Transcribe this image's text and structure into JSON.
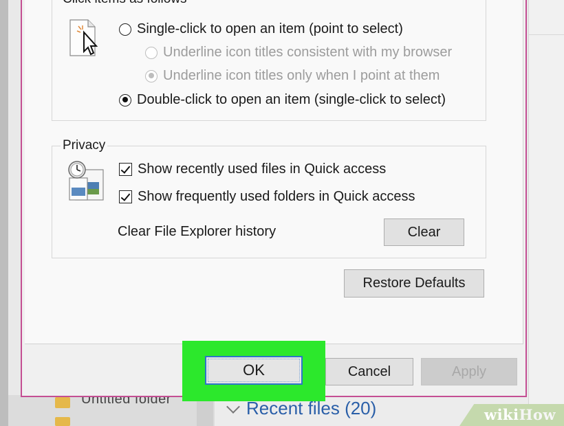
{
  "background": {
    "folder_label": "Untitled folder",
    "recent_files": "Recent files (20)",
    "watermark": {
      "wiki": "wiki",
      "how": "How"
    }
  },
  "click_items": {
    "legend": "Click items as follows",
    "single_click": "Single-click to open an item (point to select)",
    "underline_browser": "Underline icon titles consistent with my browser",
    "underline_point": "Underline icon titles only when I point at them",
    "double_click": "Double-click to open an item (single-click to select)",
    "selected": "double_click"
  },
  "privacy": {
    "legend": "Privacy",
    "show_recent_files": {
      "label": "Show recently used files in Quick access",
      "checked": true
    },
    "show_frequent_folders": {
      "label": "Show frequently used folders in Quick access",
      "checked": true
    },
    "clear_history_label": "Clear File Explorer history",
    "clear_button": "Clear"
  },
  "buttons": {
    "restore_defaults": "Restore Defaults",
    "ok": "OK",
    "cancel": "Cancel",
    "apply": "Apply"
  },
  "colors": {
    "highlight": "#2ce82c",
    "dialog_border": "#c44e93",
    "focus_border": "#2d74c9"
  }
}
